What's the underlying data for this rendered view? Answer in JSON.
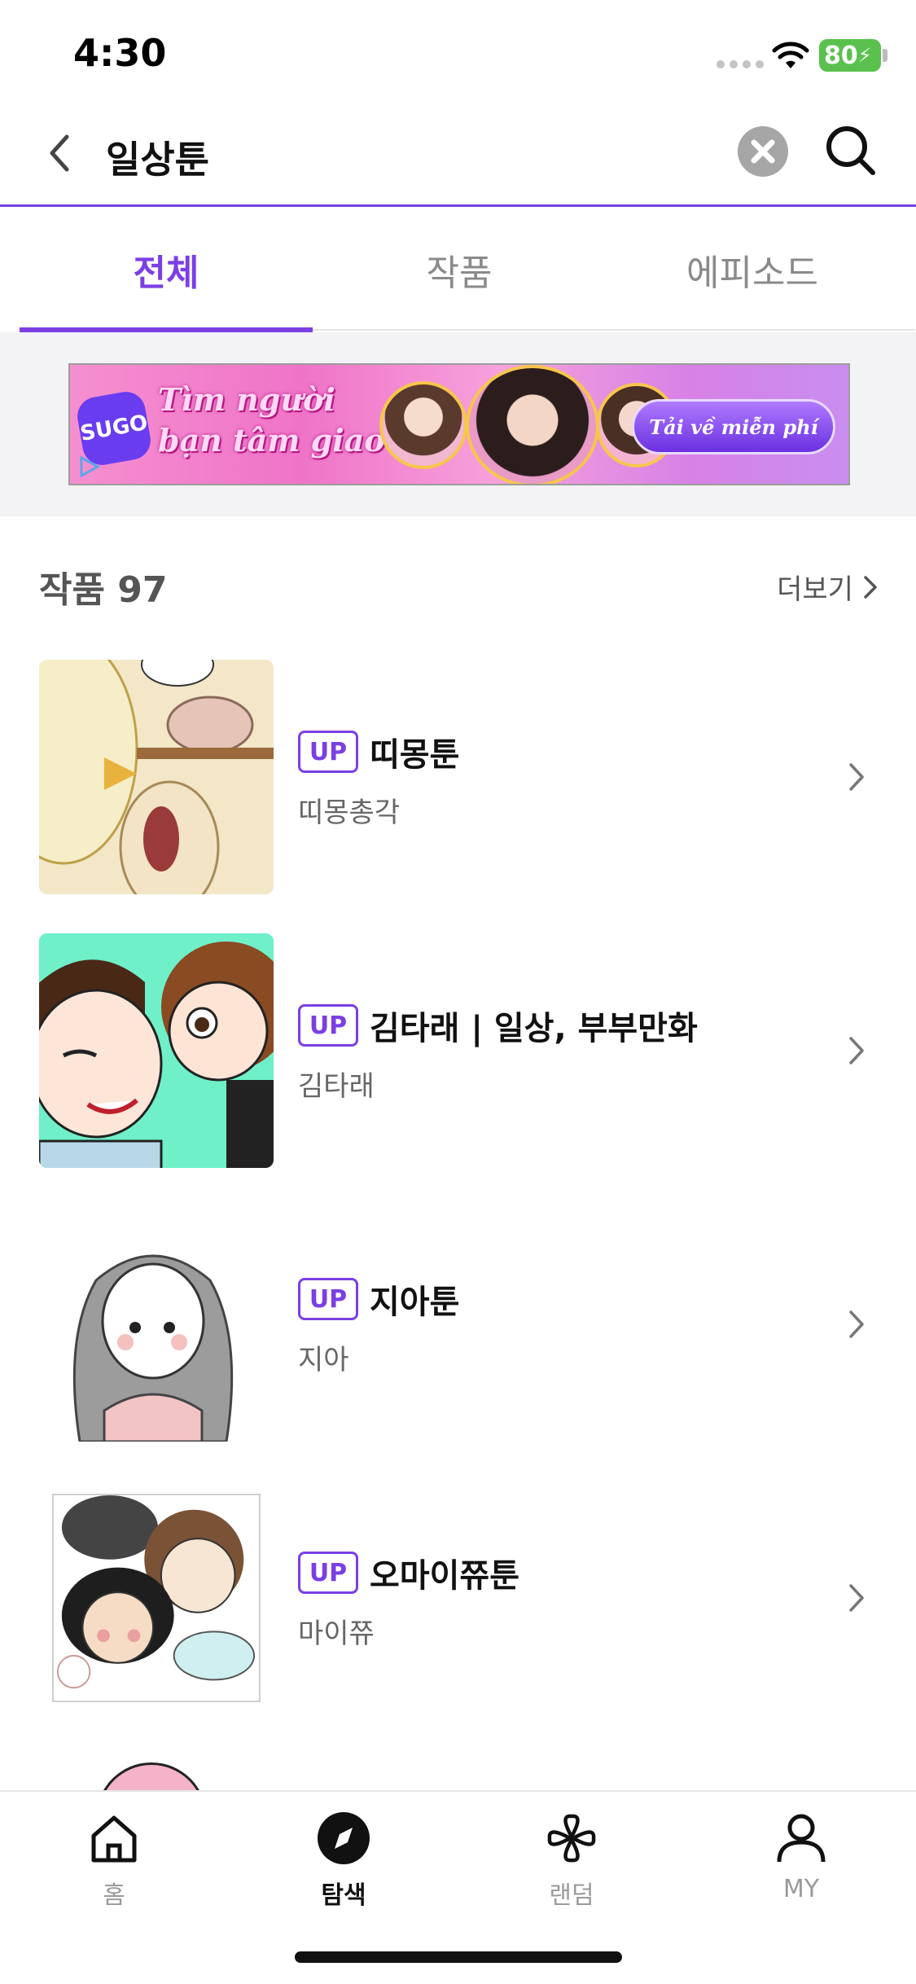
{
  "status_bar": {
    "time": "4:30",
    "battery": "80"
  },
  "search": {
    "query": "일상툰"
  },
  "tabs": [
    {
      "label": "전체",
      "active": true
    },
    {
      "label": "작품",
      "active": false
    },
    {
      "label": "에피소드",
      "active": false
    }
  ],
  "ad": {
    "logo": "SUGO",
    "headline_line1": "Tìm người",
    "headline_line2": "bạn tâm giao",
    "cta": "Tải về miễn phí"
  },
  "works_section": {
    "title": "작품 97",
    "more_label": "더보기"
  },
  "works": [
    {
      "badge": "UP",
      "title": "띠몽툰",
      "author": "띠몽총각"
    },
    {
      "badge": "UP",
      "title": "김타래 | 일상, 부부만화",
      "author": "김타래"
    },
    {
      "badge": "UP",
      "title": "지아툰",
      "author": "지아"
    },
    {
      "badge": "UP",
      "title": "오마이쮸툰",
      "author": "마이쮸"
    }
  ],
  "bottom_nav": [
    {
      "label": "홈",
      "icon": "home-icon"
    },
    {
      "label": "탐색",
      "icon": "compass-icon",
      "active": true
    },
    {
      "label": "랜덤",
      "icon": "clover-icon"
    },
    {
      "label": "MY",
      "icon": "person-icon"
    }
  ],
  "colors": {
    "accent": "#7b3fe4",
    "battery": "#5bc14e"
  }
}
